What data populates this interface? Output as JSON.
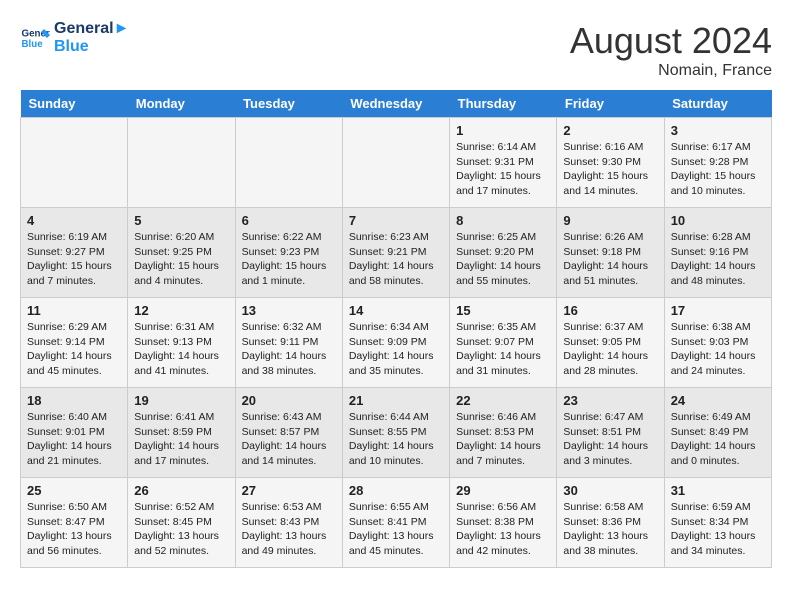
{
  "header": {
    "logo_line1": "General",
    "logo_line2": "Blue",
    "month": "August 2024",
    "location": "Nomain, France"
  },
  "weekdays": [
    "Sunday",
    "Monday",
    "Tuesday",
    "Wednesday",
    "Thursday",
    "Friday",
    "Saturday"
  ],
  "weeks": [
    [
      {
        "day": "",
        "detail": ""
      },
      {
        "day": "",
        "detail": ""
      },
      {
        "day": "",
        "detail": ""
      },
      {
        "day": "",
        "detail": ""
      },
      {
        "day": "1",
        "detail": "Sunrise: 6:14 AM\nSunset: 9:31 PM\nDaylight: 15 hours and 17 minutes."
      },
      {
        "day": "2",
        "detail": "Sunrise: 6:16 AM\nSunset: 9:30 PM\nDaylight: 15 hours and 14 minutes."
      },
      {
        "day": "3",
        "detail": "Sunrise: 6:17 AM\nSunset: 9:28 PM\nDaylight: 15 hours and 10 minutes."
      }
    ],
    [
      {
        "day": "4",
        "detail": "Sunrise: 6:19 AM\nSunset: 9:27 PM\nDaylight: 15 hours and 7 minutes."
      },
      {
        "day": "5",
        "detail": "Sunrise: 6:20 AM\nSunset: 9:25 PM\nDaylight: 15 hours and 4 minutes."
      },
      {
        "day": "6",
        "detail": "Sunrise: 6:22 AM\nSunset: 9:23 PM\nDaylight: 15 hours and 1 minute."
      },
      {
        "day": "7",
        "detail": "Sunrise: 6:23 AM\nSunset: 9:21 PM\nDaylight: 14 hours and 58 minutes."
      },
      {
        "day": "8",
        "detail": "Sunrise: 6:25 AM\nSunset: 9:20 PM\nDaylight: 14 hours and 55 minutes."
      },
      {
        "day": "9",
        "detail": "Sunrise: 6:26 AM\nSunset: 9:18 PM\nDaylight: 14 hours and 51 minutes."
      },
      {
        "day": "10",
        "detail": "Sunrise: 6:28 AM\nSunset: 9:16 PM\nDaylight: 14 hours and 48 minutes."
      }
    ],
    [
      {
        "day": "11",
        "detail": "Sunrise: 6:29 AM\nSunset: 9:14 PM\nDaylight: 14 hours and 45 minutes."
      },
      {
        "day": "12",
        "detail": "Sunrise: 6:31 AM\nSunset: 9:13 PM\nDaylight: 14 hours and 41 minutes."
      },
      {
        "day": "13",
        "detail": "Sunrise: 6:32 AM\nSunset: 9:11 PM\nDaylight: 14 hours and 38 minutes."
      },
      {
        "day": "14",
        "detail": "Sunrise: 6:34 AM\nSunset: 9:09 PM\nDaylight: 14 hours and 35 minutes."
      },
      {
        "day": "15",
        "detail": "Sunrise: 6:35 AM\nSunset: 9:07 PM\nDaylight: 14 hours and 31 minutes."
      },
      {
        "day": "16",
        "detail": "Sunrise: 6:37 AM\nSunset: 9:05 PM\nDaylight: 14 hours and 28 minutes."
      },
      {
        "day": "17",
        "detail": "Sunrise: 6:38 AM\nSunset: 9:03 PM\nDaylight: 14 hours and 24 minutes."
      }
    ],
    [
      {
        "day": "18",
        "detail": "Sunrise: 6:40 AM\nSunset: 9:01 PM\nDaylight: 14 hours and 21 minutes."
      },
      {
        "day": "19",
        "detail": "Sunrise: 6:41 AM\nSunset: 8:59 PM\nDaylight: 14 hours and 17 minutes."
      },
      {
        "day": "20",
        "detail": "Sunrise: 6:43 AM\nSunset: 8:57 PM\nDaylight: 14 hours and 14 minutes."
      },
      {
        "day": "21",
        "detail": "Sunrise: 6:44 AM\nSunset: 8:55 PM\nDaylight: 14 hours and 10 minutes."
      },
      {
        "day": "22",
        "detail": "Sunrise: 6:46 AM\nSunset: 8:53 PM\nDaylight: 14 hours and 7 minutes."
      },
      {
        "day": "23",
        "detail": "Sunrise: 6:47 AM\nSunset: 8:51 PM\nDaylight: 14 hours and 3 minutes."
      },
      {
        "day": "24",
        "detail": "Sunrise: 6:49 AM\nSunset: 8:49 PM\nDaylight: 14 hours and 0 minutes."
      }
    ],
    [
      {
        "day": "25",
        "detail": "Sunrise: 6:50 AM\nSunset: 8:47 PM\nDaylight: 13 hours and 56 minutes."
      },
      {
        "day": "26",
        "detail": "Sunrise: 6:52 AM\nSunset: 8:45 PM\nDaylight: 13 hours and 52 minutes."
      },
      {
        "day": "27",
        "detail": "Sunrise: 6:53 AM\nSunset: 8:43 PM\nDaylight: 13 hours and 49 minutes."
      },
      {
        "day": "28",
        "detail": "Sunrise: 6:55 AM\nSunset: 8:41 PM\nDaylight: 13 hours and 45 minutes."
      },
      {
        "day": "29",
        "detail": "Sunrise: 6:56 AM\nSunset: 8:38 PM\nDaylight: 13 hours and 42 minutes."
      },
      {
        "day": "30",
        "detail": "Sunrise: 6:58 AM\nSunset: 8:36 PM\nDaylight: 13 hours and 38 minutes."
      },
      {
        "day": "31",
        "detail": "Sunrise: 6:59 AM\nSunset: 8:34 PM\nDaylight: 13 hours and 34 minutes."
      }
    ]
  ]
}
